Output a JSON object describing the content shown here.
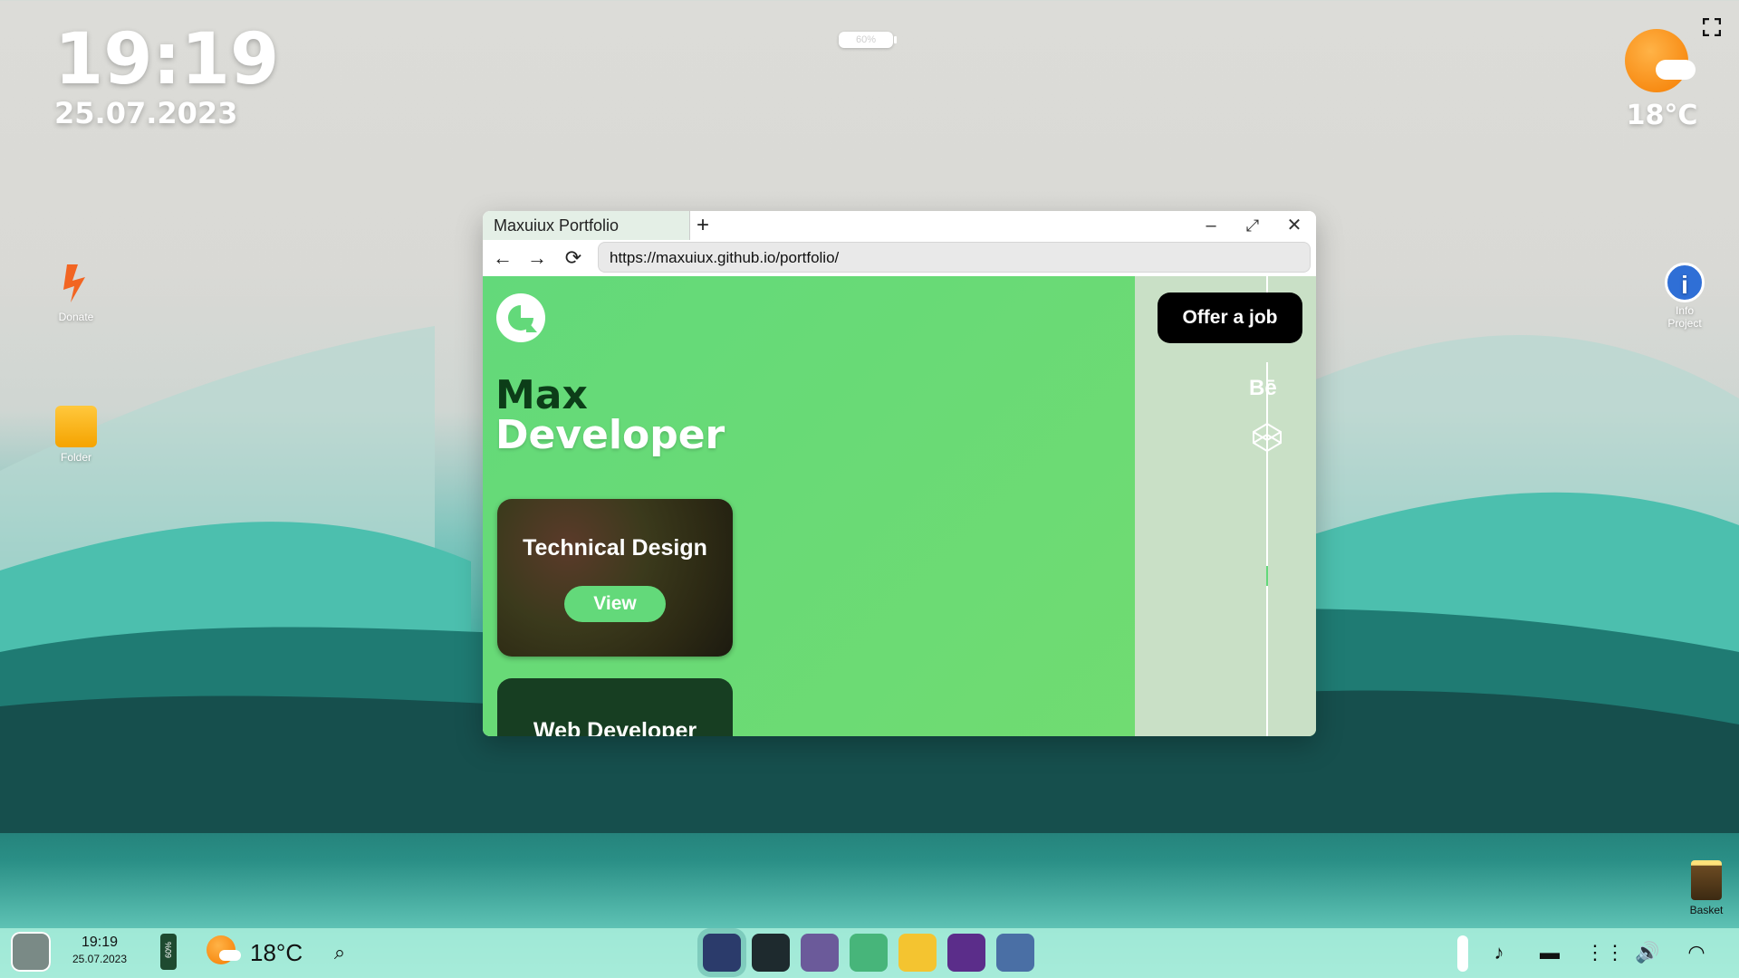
{
  "desktop": {
    "clock_time": "19:19",
    "clock_date": "25.07.2023",
    "battery_percent": "60%",
    "weather_temp": "18°C",
    "icons": [
      {
        "label": "Donate",
        "icon": "donate-icon"
      },
      {
        "label": "Folder",
        "icon": "folder-icon"
      },
      {
        "label": "Info Project",
        "icon": "info-icon"
      },
      {
        "label": "Basket",
        "icon": "trash-icon"
      }
    ]
  },
  "browser": {
    "tab_title": "Maxuiux Portfolio",
    "url": "https://maxuiux.github.io/portfolio/",
    "page": {
      "title_line1": "Max",
      "title_line2": "Developer",
      "offer_button": "Offer a job",
      "behance_label": "Bē",
      "cards": [
        {
          "title": "Technical Design",
          "button": "View"
        },
        {
          "title": "Web Developer"
        }
      ]
    }
  },
  "taskbar": {
    "time": "19:19",
    "date": "25.07.2023",
    "battery": "60%",
    "weather_temp": "18°C",
    "apps": [
      "browser-icon",
      "terminal-icon",
      "calculator-icon",
      "game-icon",
      "notes-icon",
      "paint-icon",
      "settings-icon"
    ]
  },
  "colors": {
    "accent": "#63d97a",
    "dark_green": "#0c3d18",
    "panel": "#c9e0c6"
  }
}
